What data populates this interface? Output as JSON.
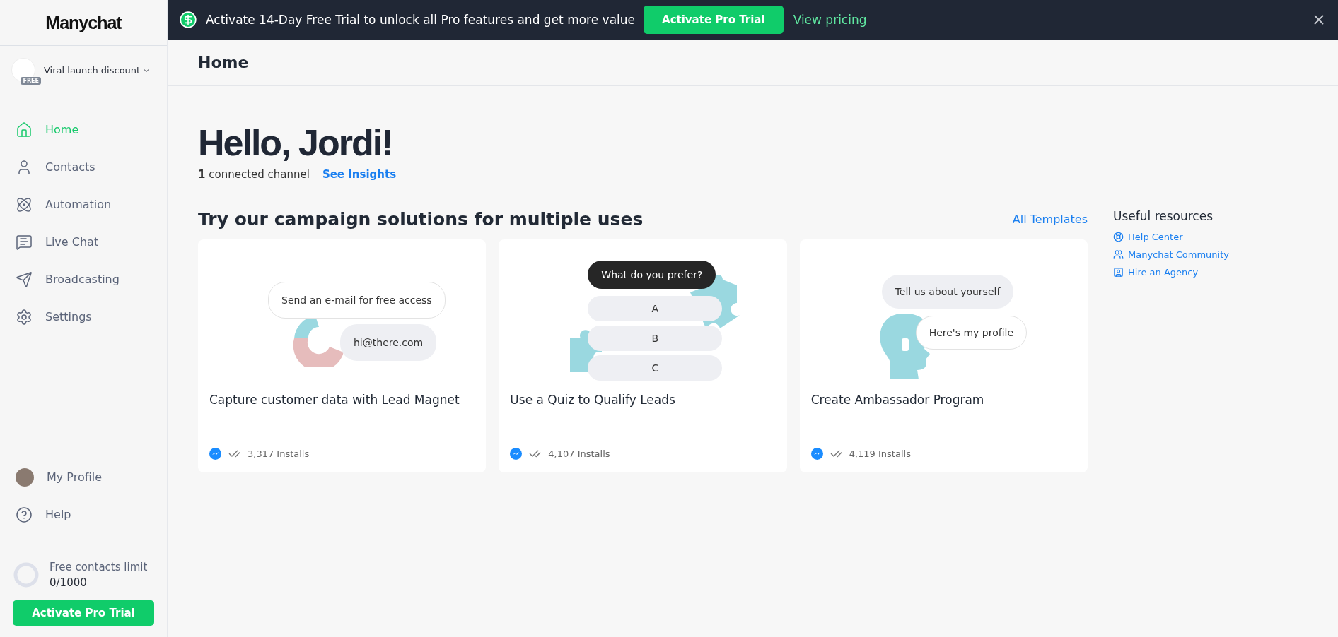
{
  "sidebar": {
    "logo": "Manychat",
    "account": {
      "name": "Viral launch discount",
      "badge": "FREE"
    },
    "nav": [
      {
        "label": "Home",
        "selected": true
      },
      {
        "label": "Contacts",
        "selected": false
      },
      {
        "label": "Automation",
        "selected": false
      },
      {
        "label": "Live Chat",
        "selected": false
      },
      {
        "label": "Broadcasting",
        "selected": false
      },
      {
        "label": "Settings",
        "selected": false
      }
    ],
    "bottom_nav": [
      {
        "label": "My Profile"
      },
      {
        "label": "Help"
      }
    ],
    "limit": {
      "label": "Free contacts limit",
      "value": "0/1000",
      "level": 0
    },
    "button": "Activate Pro Trial"
  },
  "banner": {
    "text": "Activate 14-Day Free Trial to unlock all Pro features and get more value",
    "button": "Activate Pro Trial",
    "link": "View pricing"
  },
  "header": {
    "title": "Home"
  },
  "greeting": {
    "title": "Hello, Jordi!",
    "count": "1",
    "channels": "connected channel",
    "link": "See Insights"
  },
  "campaigns": {
    "title": "Try our campaign solutions for multiple uses",
    "link": "All Templates",
    "cards": [
      {
        "kind": "lead",
        "bubbles": [
          "Send an e-mail for free access",
          "hi@there.com"
        ],
        "title": "Capture customer data with Lead Magnet",
        "installs": "3,317 Installs"
      },
      {
        "kind": "quiz",
        "bubbles": [
          "What do you prefer?",
          "A",
          "B",
          "C"
        ],
        "title": "Use a Quiz to Qualify Leads",
        "installs": "4,107 Installs"
      },
      {
        "kind": "ambassador",
        "bubbles": [
          "Tell us about yourself",
          "Here's my profile"
        ],
        "title": "Create Ambassador Program",
        "installs": "4,119 Installs"
      }
    ]
  },
  "resources": {
    "title": "Useful resources",
    "links": [
      {
        "label": "Help Center"
      },
      {
        "label": "Manychat Community"
      },
      {
        "label": "Hire an Agency"
      }
    ]
  }
}
